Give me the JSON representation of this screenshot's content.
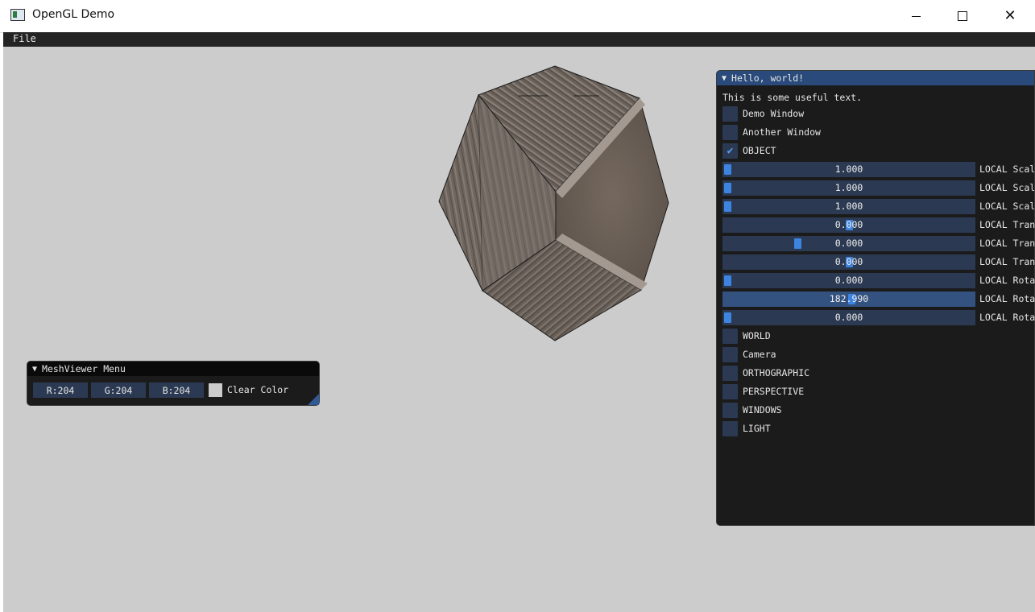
{
  "window": {
    "title": "OpenGL Demo",
    "icon": "app-window-icon"
  },
  "menubar": {
    "file_label": "File"
  },
  "hello": {
    "title": "Hello, world!",
    "text": "This is some useful text.",
    "checkboxes_top": [
      {
        "label": "Demo Window",
        "checked": false
      },
      {
        "label": "Another Window",
        "checked": false
      },
      {
        "label": "OBJECT",
        "checked": true
      }
    ],
    "sliders": [
      {
        "value": "1.000",
        "label": "LOCAL Scal",
        "fraction": 0.0
      },
      {
        "value": "1.000",
        "label": "LOCAL Scal",
        "fraction": 0.0
      },
      {
        "value": "1.000",
        "label": "LOCAL Scal",
        "fraction": 0.0
      },
      {
        "value": "0.000",
        "label": "LOCAL Tran",
        "fraction": 0.5
      },
      {
        "value": "0.000",
        "label": "LOCAL Tran",
        "fraction": 0.29
      },
      {
        "value": "0.000",
        "label": "LOCAL Tran",
        "fraction": 0.5
      },
      {
        "value": "0.000",
        "label": "LOCAL Rota",
        "fraction": 0.0
      },
      {
        "value": "182.990",
        "label": "LOCAL Rota",
        "fraction": 0.51
      },
      {
        "value": "0.000",
        "label": "LOCAL Rota",
        "fraction": 0.0
      }
    ],
    "checkboxes_bottom": [
      {
        "label": "WORLD",
        "checked": false
      },
      {
        "label": "Camera",
        "checked": false
      },
      {
        "label": "ORTHOGRAPHIC",
        "checked": false
      },
      {
        "label": "PERSPECTIVE",
        "checked": false
      },
      {
        "label": "WINDOWS",
        "checked": false
      },
      {
        "label": "LIGHT",
        "checked": false
      }
    ]
  },
  "meshmenu": {
    "title": "MeshViewer Menu",
    "r": "R:204",
    "g": "G:204",
    "b": "B:204",
    "clear_label": "Clear Color",
    "clear_color": "#cccccc"
  },
  "colors": {
    "accent": "#3d84e0",
    "frame": "#2b3a52",
    "title_active": "#294a7a",
    "viewport": "#cccccc"
  }
}
